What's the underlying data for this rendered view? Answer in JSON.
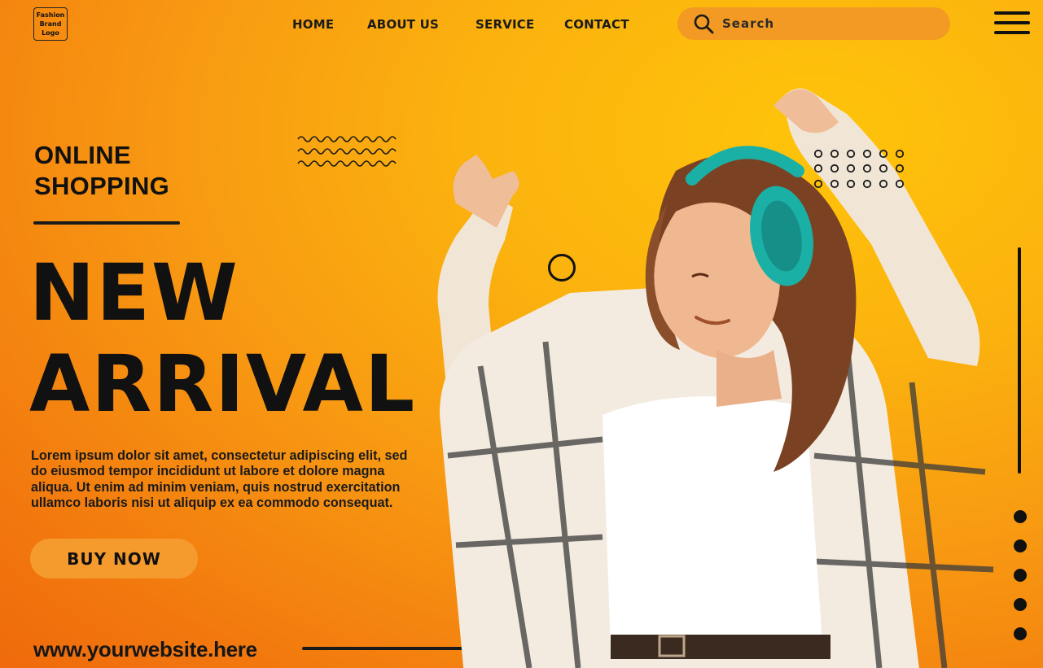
{
  "logo": {
    "lines": [
      "Fashion",
      "Brand",
      "Logo"
    ]
  },
  "nav": {
    "items": [
      "HOME",
      "ABOUT US",
      "SERVICE",
      "CONTACT"
    ]
  },
  "search": {
    "placeholder": "Search",
    "icon": "search-icon"
  },
  "menu": {
    "icon": "hamburger-menu-icon"
  },
  "hero": {
    "kicker_line1": "ONLINE",
    "kicker_line2": "SHOPPING",
    "headline_line1": "NEW",
    "headline_line2": "ARRIVAL",
    "body": "Lorem ipsum dolor sit amet, consectetur adipiscing elit, sed do eiusmod tempor incididunt ut labore et dolore magna aliqua. Ut enim ad minim veniam, quis nostrud exercitation ullamco laboris nisi ut aliquip ex ea commodo consequat.",
    "cta_label": "BUY NOW"
  },
  "footer": {
    "website": "www.yourwebsite.here"
  },
  "pager": {
    "count": 5
  },
  "colors": {
    "background_top": "#ffc40a",
    "background_bottom": "#ef6a0c",
    "search_bg": "#f29a23",
    "button_bg": "#f59b2e",
    "ink": "#111111",
    "headphones": "#1bb0a6"
  }
}
